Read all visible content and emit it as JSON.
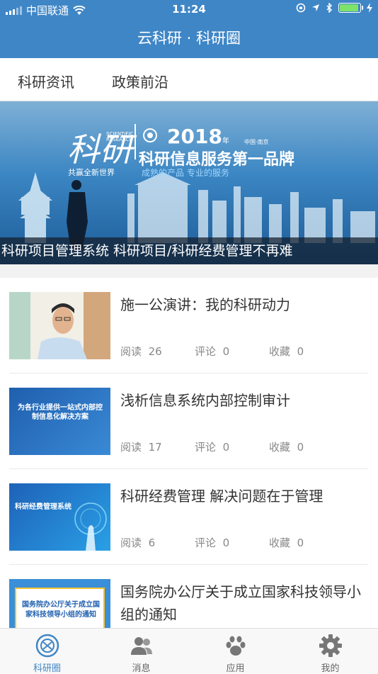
{
  "status_bar": {
    "carrier": "中国联通",
    "time": "11:24",
    "battery_level": 0.85
  },
  "header": {
    "title": "云科研 · 科研圈"
  },
  "tabs": [
    {
      "label": "科研资讯",
      "active": true
    },
    {
      "label": "政策前沿",
      "active": false
    }
  ],
  "banner": {
    "brand_char": "科研",
    "brand_en": "SCIENTIFIC RESEARCH",
    "year": "2018",
    "year_suffix": "年",
    "location": "中国·南京",
    "headline": "科研信息服务第一品牌",
    "slogan_left": "共赢全新世界",
    "slogan_right": "成熟的产品  专业的服务",
    "caption": "科研项目管理系统 科研项目/科研经费管理不再难"
  },
  "articles": [
    {
      "title": "施一公演讲：我的科研动力",
      "read_label": "阅读",
      "reads": "26",
      "comment_label": "评论",
      "comments": "0",
      "fav_label": "收藏",
      "favs": "0",
      "thumb_text": ""
    },
    {
      "title": "浅析信息系统内部控制审计",
      "read_label": "阅读",
      "reads": "17",
      "comment_label": "评论",
      "comments": "0",
      "fav_label": "收藏",
      "favs": "0",
      "thumb_text": "为各行业提供一站式内部控制信息化解决方案"
    },
    {
      "title": "科研经费管理 解决问题在于管理",
      "read_label": "阅读",
      "reads": "6",
      "comment_label": "评论",
      "comments": "0",
      "fav_label": "收藏",
      "favs": "0",
      "thumb_text": "科研经费管理系统"
    },
    {
      "title": "国务院办公厅关于成立国家科技领导小组的通知",
      "read_label": "",
      "reads": "",
      "comment_label": "",
      "comments": "",
      "fav_label": "",
      "favs": "",
      "thumb_text": "国务院办公厅关于成立国家科技领导小组的通知"
    }
  ],
  "tabbar": [
    {
      "label": "科研圈",
      "icon": "research-circle-icon",
      "active": true
    },
    {
      "label": "消息",
      "icon": "people-icon",
      "active": false
    },
    {
      "label": "应用",
      "icon": "paw-icon",
      "active": false
    },
    {
      "label": "我的",
      "icon": "gear-icon",
      "active": false
    }
  ],
  "colors": {
    "accent": "#3f86c6",
    "header_bg": "#3f86c6"
  }
}
